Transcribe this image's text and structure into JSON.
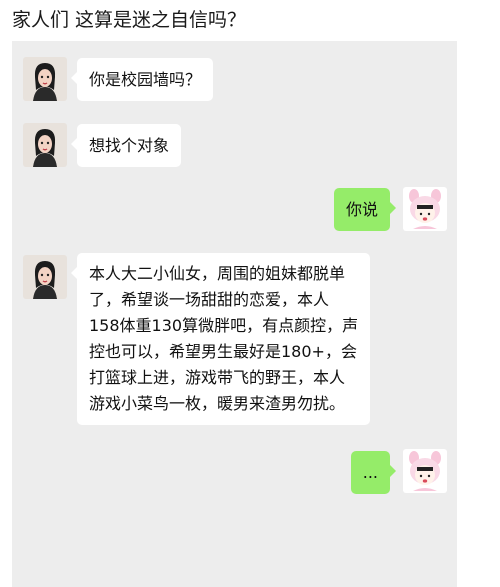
{
  "post": {
    "title": "家人们 这算是迷之自信吗？"
  },
  "chat": {
    "messages": [
      {
        "side": "left",
        "avatar": "girl-avatar",
        "text": "你是校园墙吗？"
      },
      {
        "side": "left",
        "avatar": "girl-avatar",
        "text": "想找个对象"
      },
      {
        "side": "right",
        "avatar": "cartoon-bunny-avatar",
        "text": "你说"
      },
      {
        "side": "left",
        "avatar": "girl-avatar",
        "lines": [
          "本人大二小仙女，周围的姐妹都脱单",
          "了，希望谈一场甜甜的恋爱，本人",
          "158体重130算微胖吧，有点颜控，声",
          "控也可以，希望男生最好是180+，会",
          "打篮球上进，游戏带飞的野王，本人",
          "游戏小菜鸟一枚，暖男来渣男勿扰。"
        ]
      },
      {
        "side": "right",
        "avatar": "cartoon-bunny-avatar",
        "text": "..."
      }
    ]
  },
  "colors": {
    "page_bg": "#ffffff",
    "chat_bg": "#ededed",
    "left_bubble": "#ffffff",
    "right_bubble": "#95ec69"
  }
}
